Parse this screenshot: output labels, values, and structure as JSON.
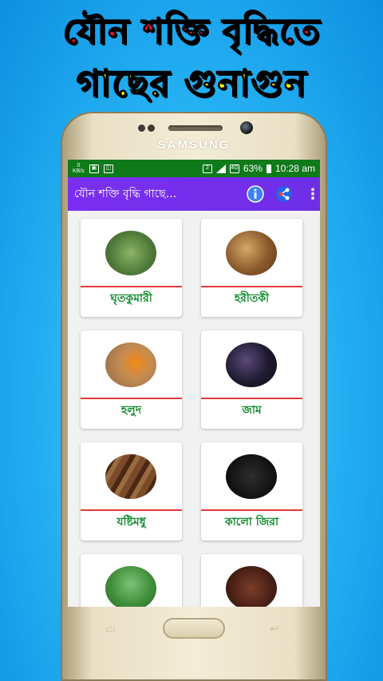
{
  "banner": {
    "line1": "যৌন শক্তি বৃদ্ধিতে",
    "line2": "গাছের গুনাগুন"
  },
  "phone": {
    "brand": "SAMSUNG"
  },
  "statusbar": {
    "left_small": "0\nKB/s",
    "battery": "63%",
    "time": "10:28 am"
  },
  "appbar": {
    "title": "যৌন শক্তি বৃদ্ধি গাছে...",
    "more_icon": "⋮",
    "icons": [
      "info-icon",
      "share-icon",
      "more-vert-icon"
    ]
  },
  "items": [
    {
      "label": "ঘৃতকুমারী",
      "image": "aloe"
    },
    {
      "label": "হরীতকী",
      "image": "haritaki"
    },
    {
      "label": "হলুদ",
      "image": "turmeric"
    },
    {
      "label": "জাম",
      "image": "jam"
    },
    {
      "label": "যষ্টিমধু",
      "image": "mulethi"
    },
    {
      "label": "কালো জিরা",
      "image": "kalojira"
    },
    {
      "label": "",
      "image": "leaf"
    },
    {
      "label": "",
      "image": "clove"
    }
  ],
  "colors": {
    "status_bar": "#0f7a1a",
    "app_bar": "#7a2ff0",
    "label_text": "#0b8a2a",
    "divider": "#e53935"
  }
}
